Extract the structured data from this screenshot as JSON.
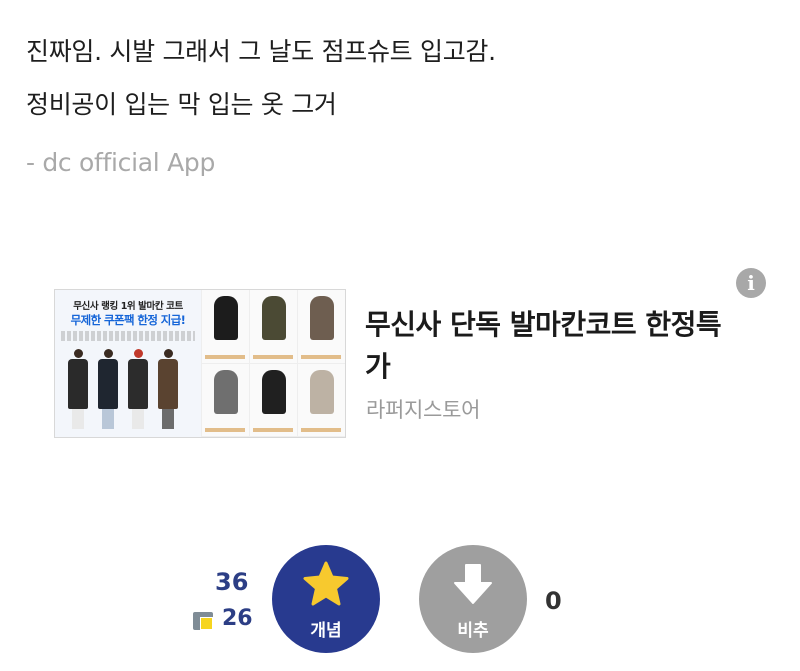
{
  "post": {
    "line1": "진짜임. 시발 그래서 그 날도 점프슈트 입고감.",
    "line2": "정비공이 입는 막 입는 옷 그거",
    "signature": "- dc official App"
  },
  "ad": {
    "info_icon": "info-icon",
    "thumbnail": {
      "headline_top": "무신사 랭킹 1위 발마칸 코트",
      "headline_main": "무제한 쿠폰팩 한정 지급!"
    },
    "title": "무신사 단독 발마칸코트 한정특가",
    "store": "라퍼지스토어"
  },
  "votes": {
    "recommend_count": "36",
    "fix_count": "26",
    "recommend_label": "개념",
    "recommend_icon": "star-icon",
    "nonrecommend_label": "비추",
    "nonrecommend_icon": "arrow-down-icon",
    "nonrecommend_count": "0",
    "colors": {
      "recommend": "#283a8f",
      "nonrecommend": "#9f9f9f",
      "star": "#f7c92e"
    }
  }
}
